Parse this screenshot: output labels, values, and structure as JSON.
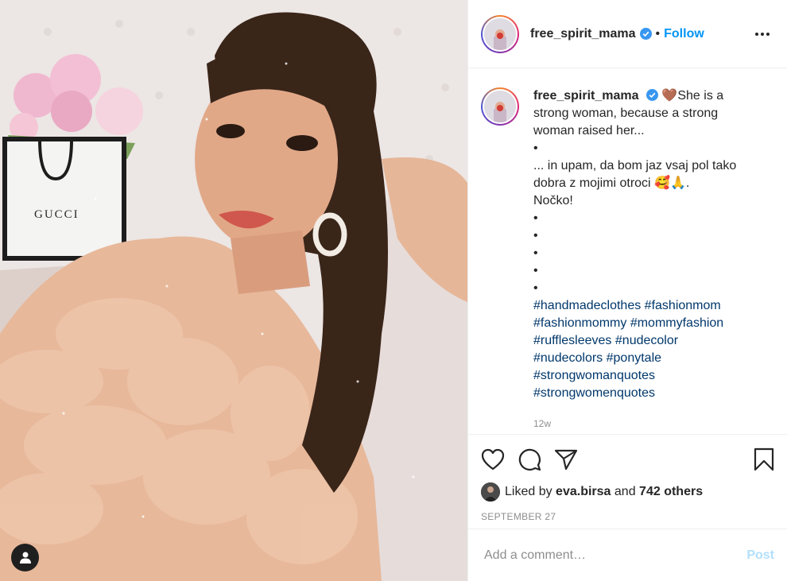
{
  "post": {
    "photo": {
      "bag_brand": "GUCCI",
      "user_tag_icon": "person-icon"
    },
    "header": {
      "username": "free_spirit_mama",
      "verified_icon": "verified-badge-icon",
      "separator": "•",
      "follow_label": "Follow",
      "more_icon": "more-options-icon"
    },
    "caption": {
      "username": "free_spirit_mama",
      "lines": [
        "🤎She is a",
        "strong woman, because a strong",
        "woman raised her...",
        "•",
        "... in upam, da bom jaz vsaj pol tako",
        "dobra z mojimi otroci 🥰🙏.",
        "Nočko!",
        "•",
        "•",
        "•",
        "•",
        "•"
      ],
      "hashtag_lines": [
        [
          "#handmadeclothes",
          "#fashionmom"
        ],
        [
          "#fashionmommy",
          "#mommyfashion"
        ],
        [
          "#rufflesleeves",
          "#nudecolor"
        ],
        [
          "#nudecolors",
          "#ponytale"
        ],
        [
          "#strongwomanquotes"
        ],
        [
          "#strongwomenquotes"
        ]
      ],
      "time_ago": "12w"
    },
    "actions": {
      "like_icon": "heart-icon",
      "comment_icon": "comment-icon",
      "share_icon": "share-icon",
      "save_icon": "bookmark-icon",
      "liked_prefix": "Liked by",
      "liked_user": "eva.birsa",
      "liked_and": "and",
      "liked_others": "742 others",
      "date": "SEPTEMBER 27"
    },
    "comment_box": {
      "placeholder": "Add a comment…",
      "post_label": "Post"
    },
    "colors": {
      "link": "#0095f6",
      "hashtag": "#00376b",
      "muted": "#8e8e8e",
      "post_disabled": "#b2dffc"
    }
  }
}
